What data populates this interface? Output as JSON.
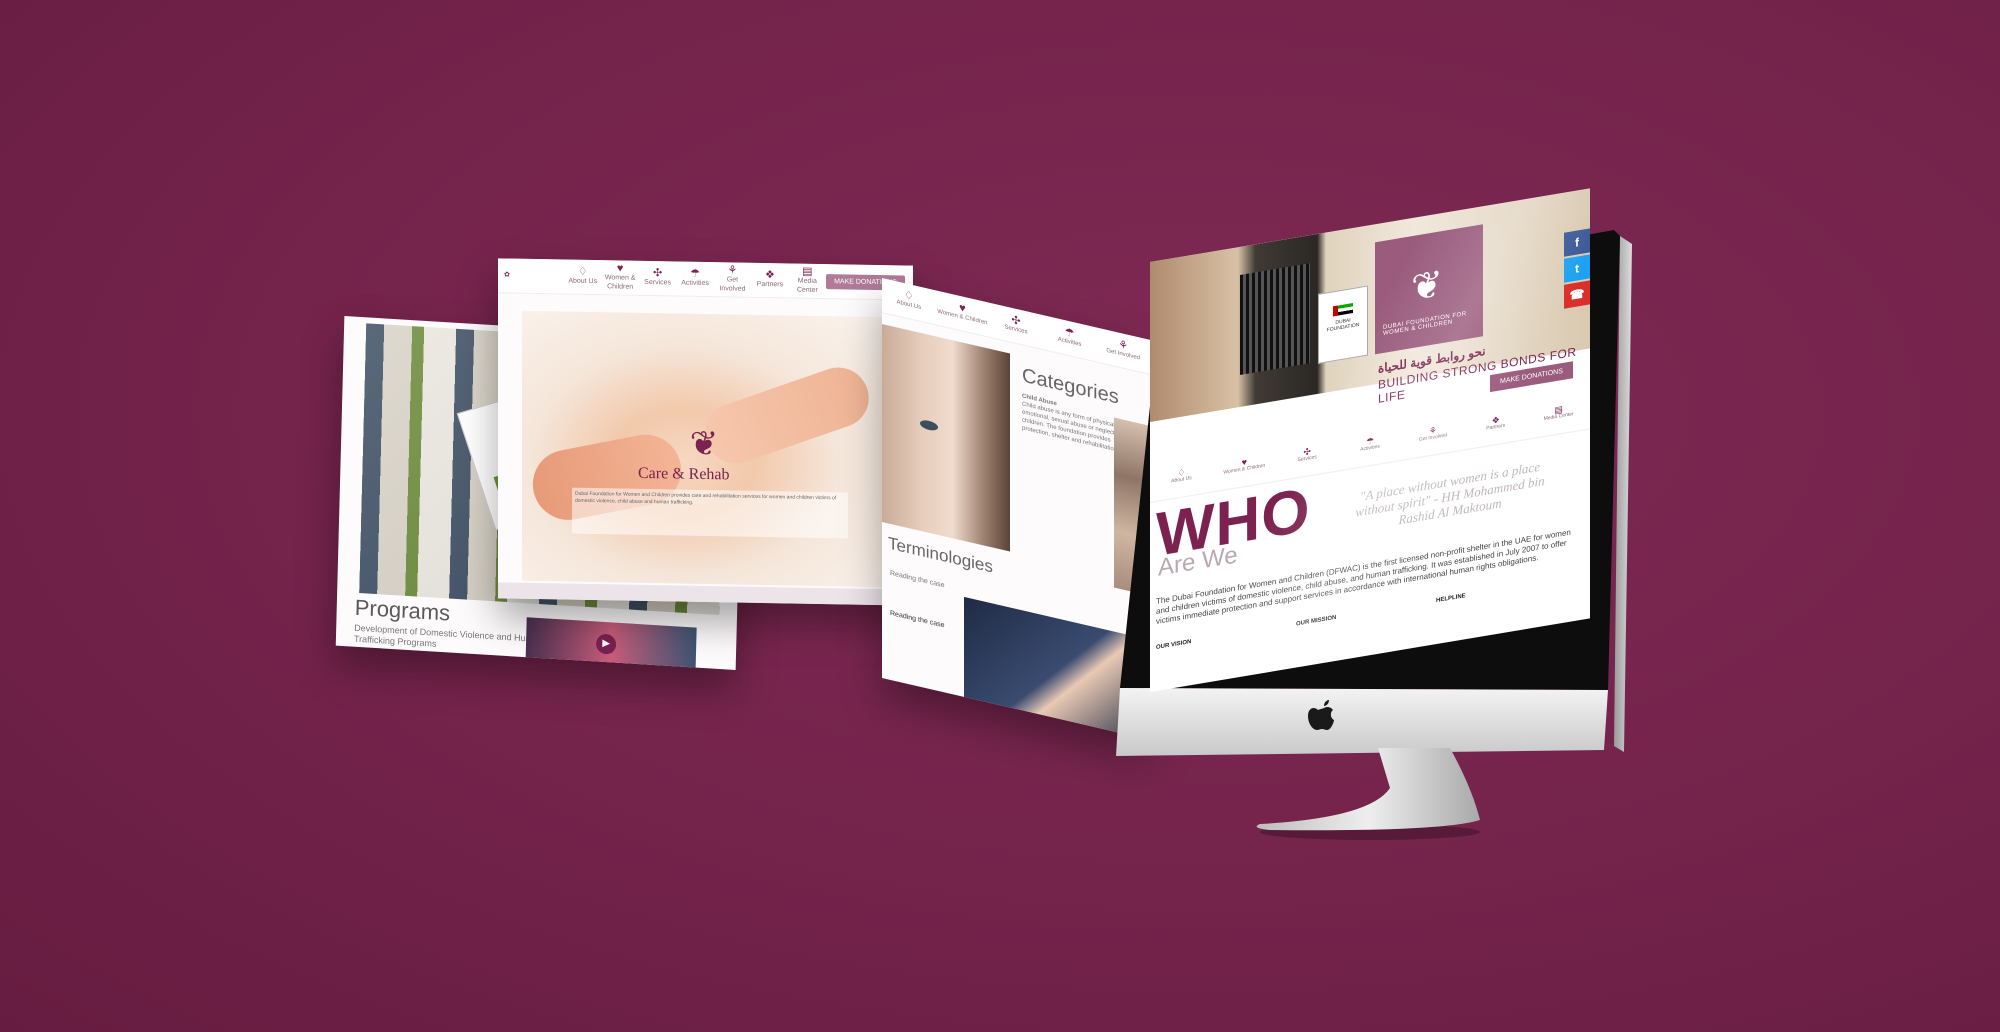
{
  "colors": {
    "background": "#74234b",
    "brand": "#7b2250",
    "brand_light": "#9a5b7d"
  },
  "page_programs": {
    "title": "Programs",
    "subtitle": "Development of Domestic Violence and Human Trafficking Programs"
  },
  "page_care": {
    "nav_items": [
      "About Us",
      "Women & Children",
      "Services",
      "Activities",
      "Get Involved",
      "Partners",
      "Media Center"
    ],
    "donate": "MAKE DONATIONS",
    "title": "Care & Rehab",
    "body": "Dubai Foundation for Women and Children provides care and rehabilitation services for women and children victims of domestic violence, child abuse and human trafficking."
  },
  "page_categories": {
    "title": "Categories",
    "subheading": "Child Abuse",
    "body": "Child abuse is any form of physical, emotional, sexual abuse or neglect of children. The foundation provides protection, shelter and rehabilitation.",
    "terminologies_title": "Terminologies",
    "term_1": "Reading the case",
    "term_2": "Reading the case"
  },
  "imac_screen": {
    "org_name": "DUBAI FOUNDATION FOR WOMEN & CHILDREN",
    "tagline_arabic": "نحو روابط قوية للحياة",
    "tagline": "BUILDING STRONG BONDS FOR LIFE",
    "donate": "MAKE DONATIONS",
    "sign_text": "DUBAI FOUNDATION",
    "social": [
      "f",
      "t",
      "☎"
    ],
    "nav_items": [
      "About Us",
      "Women & Children",
      "Services",
      "Activities",
      "Get Involved",
      "Partners",
      "Media Center"
    ],
    "who": "WHO",
    "are_we": "Are We",
    "quote": "\"A place without women is a place without spirit\" - HH Mohammed bin Rashid Al Maktoum",
    "about": "The Dubai Foundation for Women and Children (DFWAC) is the first licensed non-profit shelter in the UAE for women and children victims of domestic violence, child abuse, and human trafficking. It was established in July 2007 to offer victims immediate protection and support services in accordance with international human rights obligations.",
    "tabs": [
      "OUR VISION",
      "OUR MISSION",
      "HELPLINE"
    ]
  }
}
